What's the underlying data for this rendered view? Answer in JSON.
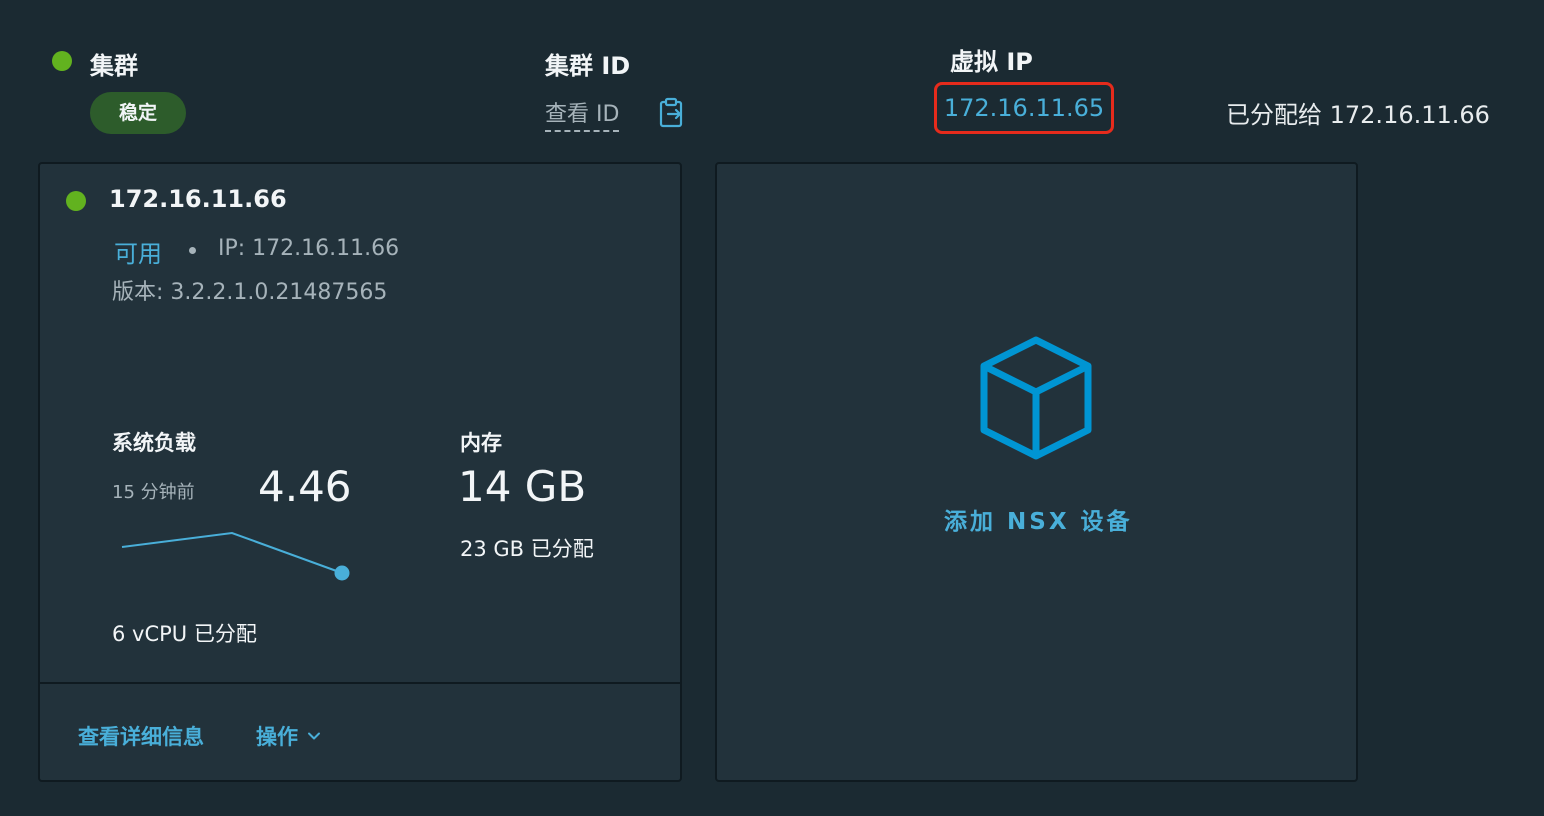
{
  "header": {
    "cluster": {
      "title": "集群",
      "status_color": "#62b21f",
      "badge": "稳定"
    },
    "cluster_id": {
      "title": "集群 ID",
      "view_link": "查看 ID",
      "copy_icon": "copy-clipboard-icon"
    },
    "virtual_ip": {
      "title": "虚拟 IP",
      "value": "172.16.11.65",
      "assigned_label": "已分配给 172.16.11.66"
    }
  },
  "node_card": {
    "status_color": "#62b21f",
    "title": "172.16.11.66",
    "availability": "可用",
    "ip_label": "IP: 172.16.11.66",
    "version_label": "版本: 3.2.2.1.0.21487565",
    "system_load": {
      "title": "系统负载",
      "period": "15 分钟前",
      "value": "4.46",
      "vcpu": "6 vCPU 已分配"
    },
    "memory": {
      "title": "内存",
      "value": "14 GB",
      "allocated": "23 GB 已分配"
    },
    "footer": {
      "details_link": "查看详细信息",
      "actions_label": "操作"
    }
  },
  "add_card": {
    "icon": "cube-icon",
    "label": "添加 NSX 设备"
  },
  "colors": {
    "background": "#1b2a32",
    "card": "#22323b",
    "accent_blue": "#49afd9",
    "highlight_red": "#e62b1c",
    "success_green": "#62b21f"
  }
}
